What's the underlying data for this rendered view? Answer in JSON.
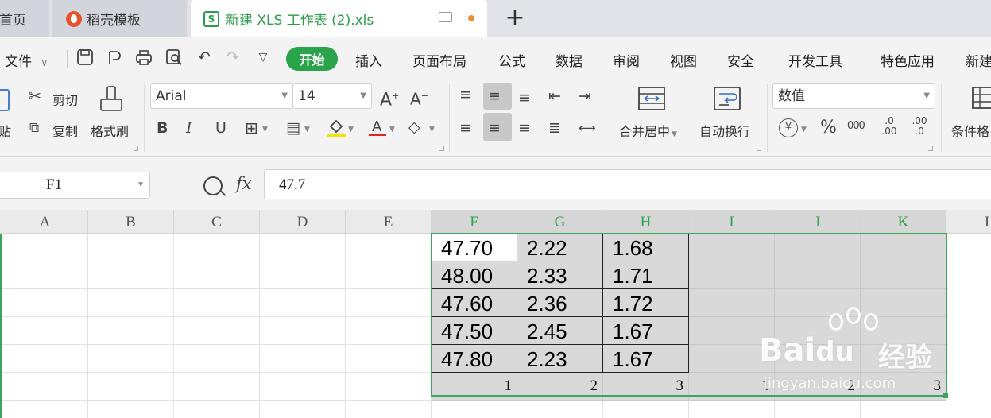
{
  "tabs": {
    "home_label": "首页",
    "template_label": "稻壳模板",
    "doc_label": "新建 XLS 工作表 (2).xls",
    "doc_icon": "S",
    "add_label": "+"
  },
  "menu": {
    "file_label": "文件",
    "active": "开始",
    "items": [
      "插入",
      "页面布局",
      "公式",
      "数据",
      "审阅",
      "视图",
      "安全",
      "开发工具",
      "特色应用",
      "新建"
    ]
  },
  "ribbon": {
    "paste_label": "粘贴",
    "cut_label": "剪切",
    "copy_label": "复制",
    "format_painter_label": "格式刷",
    "font_name": "Arial",
    "font_size": "14",
    "bold": "B",
    "italic": "I",
    "underline": "U",
    "merge_label": "合并居中",
    "wrap_label": "自动换行",
    "number_format": "数值",
    "conditional_label": "条件格",
    "percent": "%",
    "thousands": "000",
    "inc_decimal": ".0 .00",
    "dec_decimal": ".00 .0"
  },
  "formula_bar": {
    "cell_ref": "F1",
    "fx": "fx",
    "content": "47.7"
  },
  "grid": {
    "columns": [
      "A",
      "B",
      "C",
      "D",
      "E",
      "F",
      "G",
      "H",
      "I",
      "J",
      "K",
      "L"
    ],
    "rows": [
      [
        "47.70",
        "2.22",
        "1.68"
      ],
      [
        "48.00",
        "2.33",
        "1.71"
      ],
      [
        "47.60",
        "2.36",
        "1.72"
      ],
      [
        "47.50",
        "2.45",
        "1.67"
      ],
      [
        "47.80",
        "2.23",
        "1.67"
      ]
    ],
    "index_row": [
      "1",
      "2",
      "3",
      "1",
      "2",
      "3"
    ]
  },
  "watermark": {
    "brand": "Bai",
    "brand2": "du",
    "cn": "经验",
    "url": "jingyan.baidu.com"
  },
  "colors": {
    "accent": "#2aa34a",
    "selection": "#3aa65a",
    "header_bg": "#eaeaea"
  }
}
